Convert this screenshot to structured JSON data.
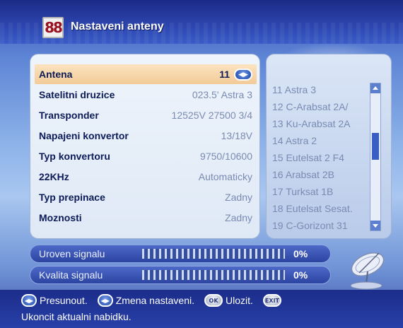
{
  "header": {
    "logo_text": "88",
    "title": "Nastaveni anteny"
  },
  "settings": [
    {
      "label": "Antena",
      "value": "11"
    },
    {
      "label": "Satelitni druzice",
      "value": "023.5' Astra 3"
    },
    {
      "label": "Transponder",
      "value": "12525V 27500 3/4"
    },
    {
      "label": "Napajeni konvertor",
      "value": "13/18V"
    },
    {
      "label": "Typ konvertoru",
      "value": "9750/10600"
    },
    {
      "label": "22KHz",
      "value": "Automaticky"
    },
    {
      "label": "Typ prepinace",
      "value": "Zadny"
    },
    {
      "label": "Moznosti",
      "value": "Zadny"
    }
  ],
  "satellite_list": [
    "11 Astra 3",
    "12 C-Arabsat 2A/",
    "13 Ku-Arabsat 2A",
    "14 Astra 2",
    "15 Eutelsat 2 F4",
    "16 Arabsat 2B",
    "17 Turksat 1B",
    "18 Eutelsat Sesat.",
    "19 C-Gorizont 31"
  ],
  "signal": {
    "level_label": "Uroven signalu",
    "level_value": "0%",
    "level_fraction": 0,
    "quality_label": "Kvalita signalu",
    "quality_value": "0%",
    "quality_fraction": 0
  },
  "footer": {
    "move": "Presunout.",
    "change": "Zmena nastaveni.",
    "ok_icon": "OK",
    "save": "Ulozit.",
    "exit_icon": "EXIT",
    "exit_text": "Ukoncit aktualni nabidku."
  },
  "icons": {
    "selector": "left-right-arrows-icon",
    "move": "arrows-icon",
    "ok": "ok-icon",
    "exit": "exit-icon",
    "dish": "satellite-dish-icon"
  }
}
